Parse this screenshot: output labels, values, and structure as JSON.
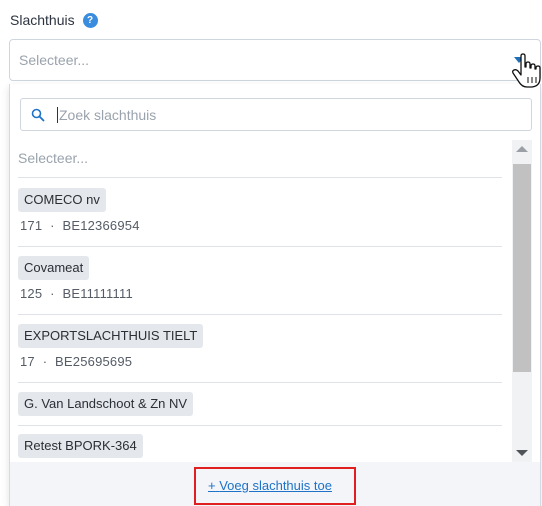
{
  "field": {
    "label": "Slachthuis",
    "help_icon": "help-icon",
    "help_glyph": "?"
  },
  "select": {
    "placeholder": "Selecteer...",
    "caret_icon": "chevron-down-icon"
  },
  "dropdown": {
    "search_placeholder": "Zoek slachthuis",
    "search_icon": "search-icon",
    "list_placeholder": "Selecteer...",
    "items": [
      {
        "name": "COMECO nv",
        "number": "171",
        "sep": "·",
        "vat": "BE12366954"
      },
      {
        "name": "Covameat",
        "number": "125",
        "sep": "·",
        "vat": "BE11111111"
      },
      {
        "name": "EXPORTSLACHTHUIS TIELT",
        "number": "17",
        "sep": "·",
        "vat": "BE25695695"
      },
      {
        "name": "G. Van Landschoot & Zn NV"
      },
      {
        "name": "Retest BPORK-364"
      }
    ],
    "add_link_prefix": "+",
    "add_link_label": "Voeg slachthuis toe"
  },
  "colors": {
    "accent": "#1e73c8",
    "help_badge": "#3a8dde",
    "highlight_border": "#e02020",
    "chip_bg": "#e4e7eb"
  }
}
